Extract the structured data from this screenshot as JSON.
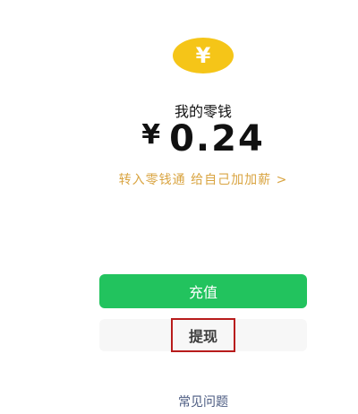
{
  "wallet": {
    "coin_icon": "yuan-coin-icon",
    "coin_symbol": "¥",
    "coin_color": "#f5c518",
    "title": "我的零钱",
    "currency": "¥",
    "amount": "0.24",
    "promo_link": "转入零钱通 给自己加加薪 >",
    "promo_color": "#d9a441"
  },
  "actions": {
    "recharge_label": "充值",
    "recharge_color": "#22c35e",
    "withdraw_label": "提现",
    "withdraw_highlight_color": "#b81c1c"
  },
  "footer": {
    "faq_label": "常见问题"
  }
}
